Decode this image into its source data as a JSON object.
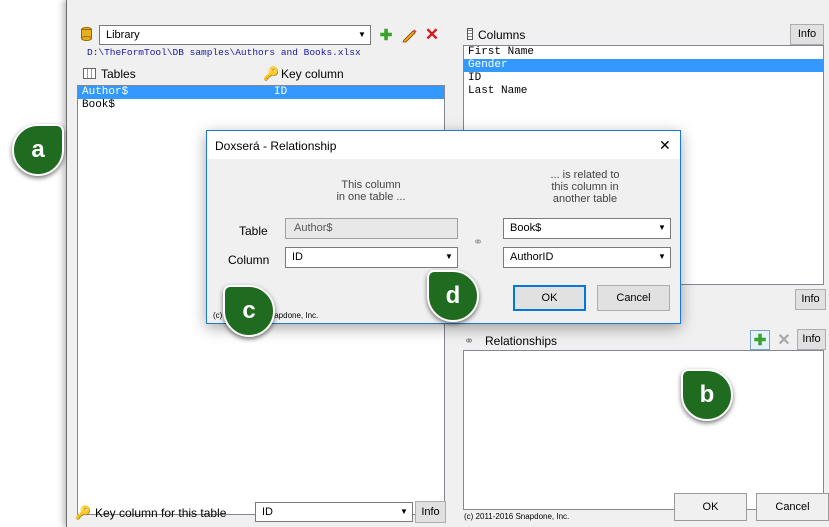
{
  "library": {
    "selected": "Library",
    "path": "D:\\TheFormTool\\DB samples\\Authors and Books.xlsx"
  },
  "tables": {
    "header_tables": "Tables",
    "header_key": "Key column",
    "rows": [
      {
        "name": "Author$",
        "key": "ID"
      },
      {
        "name": "Book$",
        "key": ""
      }
    ]
  },
  "columns": {
    "header": "Columns",
    "info": "Info",
    "items": [
      "First Name",
      "Gender",
      "ID",
      "Last Name"
    ]
  },
  "mid_info": "Info",
  "relationships": {
    "header": "Relationships",
    "info": "Info"
  },
  "bottom": {
    "key_label": "Key column for this table",
    "key_value": "ID",
    "info": "Info",
    "copyright": "(c) 2011-2016 Snapdone, Inc.",
    "ok": "OK",
    "cancel": "Cancel"
  },
  "dialog": {
    "title": "Doxserá - Relationship",
    "close": "✕",
    "left_heading": "This column\nin one table ...",
    "right_heading": "... is related to\nthis column in\nanother table",
    "table_label": "Table",
    "table_value": "Author$",
    "column_label": "Column",
    "column_value": "ID",
    "right_table": "Book$",
    "right_column": "AuthorID",
    "ok": "OK",
    "cancel": "Cancel",
    "copyright": "(c) 2011-2016 Snapdone, Inc."
  },
  "callouts": {
    "a": "a",
    "b": "b",
    "c": "c",
    "d": "d"
  },
  "colors": {
    "callout": "#1f6b1f",
    "selection": "#3399ff",
    "path_link": "#1a1aa6"
  }
}
